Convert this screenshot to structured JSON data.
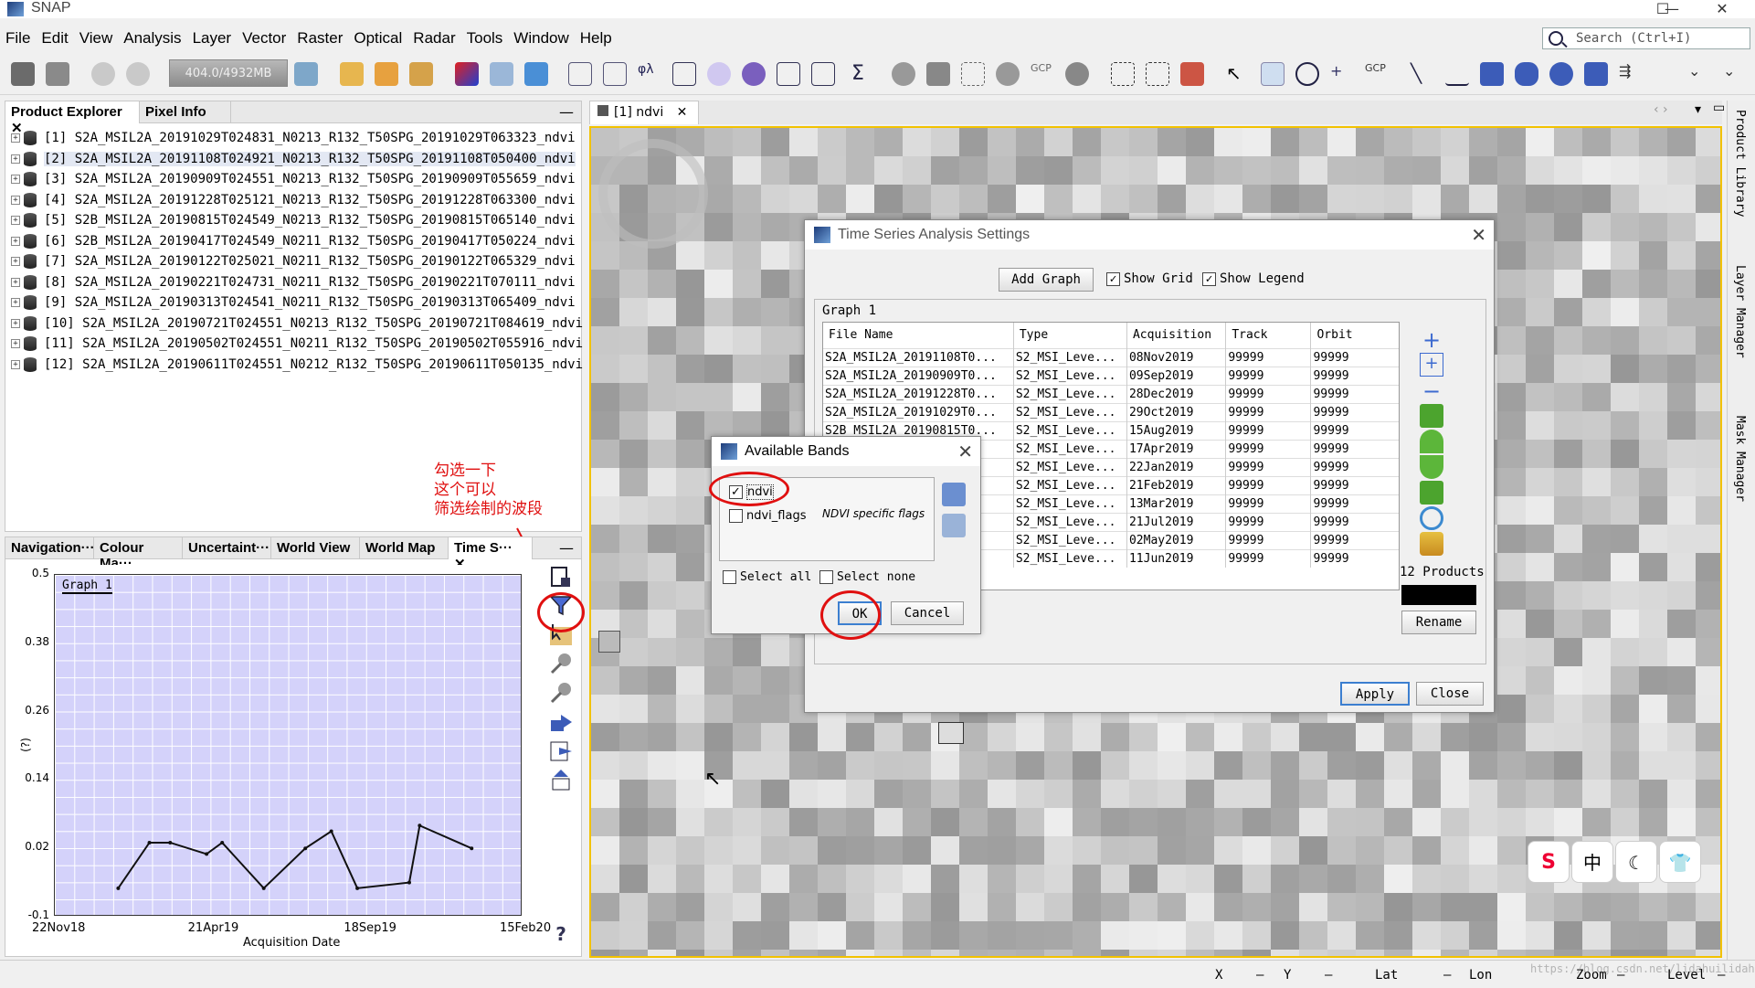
{
  "window": {
    "title": "SNAP",
    "controls": [
      "—",
      "☐",
      "✕"
    ]
  },
  "menu": [
    "File",
    "Edit",
    "View",
    "Analysis",
    "Layer",
    "Vector",
    "Raster",
    "Optical",
    "Radar",
    "Tools",
    "Window",
    "Help"
  ],
  "search": {
    "placeholder": "Search (Ctrl+I)"
  },
  "toolbar": {
    "memory": "404.0/4932MB",
    "gcp_label": "GCP"
  },
  "product_explorer": {
    "tabs": [
      "Product Explorer",
      "Pixel Info"
    ],
    "items": [
      "[1]  S2A_MSIL2A_20191029T024831_N0213_R132_T50SPG_20191029T063323_ndvi",
      "[2]  S2A_MSIL2A_20191108T024921_N0213_R132_T50SPG_20191108T050400_ndvi",
      "[3]  S2A_MSIL2A_20190909T024551_N0213_R132_T50SPG_20190909T055659_ndvi",
      "[4]  S2A_MSIL2A_20191228T025121_N0213_R132_T50SPG_20191228T063300_ndvi",
      "[5]  S2B_MSIL2A_20190815T024549_N0213_R132_T50SPG_20190815T065140_ndvi",
      "[6]  S2B_MSIL2A_20190417T024549_N0211_R132_T50SPG_20190417T050224_ndvi",
      "[7]  S2A_MSIL2A_20190122T025021_N0211_R132_T50SPG_20190122T065329_ndvi",
      "[8]  S2A_MSIL2A_20190221T024731_N0211_R132_T50SPG_20190221T070111_ndvi",
      "[9]  S2A_MSIL2A_20190313T024541_N0211_R132_T50SPG_20190313T065409_ndvi",
      "[10]  S2A_MSIL2A_20190721T024551_N0213_R132_T50SPG_20190721T084619_ndvi",
      "[11]  S2A_MSIL2A_20190502T024551_N0211_R132_T50SPG_20190502T055916_ndvi",
      "[12]  S2A_MSIL2A_20190611T024551_N0212_R132_T50SPG_20190611T050135_ndvi"
    ],
    "selected_index": 1
  },
  "annotation": {
    "line1": "勾选一下",
    "line2": "这个可以",
    "line3": "筛选绘制的波段"
  },
  "bottom_tabs": [
    "Navigation···",
    "Colour Ma···",
    "Uncertaint···",
    "World View",
    "World Map",
    "Time S···"
  ],
  "image_view": {
    "tab": "[1] ndvi"
  },
  "right_strip": [
    "Product Library",
    "Layer Manager",
    "Mask Manager"
  ],
  "status": {
    "x": "X",
    "y": "Y",
    "lat": "Lat",
    "lon": "Lon",
    "zoom": "Zoom",
    "level": "Level",
    "watermark": "https://blog.csdn.net/lidahuilidahui"
  },
  "ts_settings": {
    "title": "Time Series Analysis Settings",
    "add_graph": "Add Graph",
    "show_grid": "Show Grid",
    "show_legend": "Show Legend",
    "graph_label": "Graph 1",
    "columns": [
      "File Name",
      "Type",
      "Acquisition",
      "Track",
      "Orbit"
    ],
    "rows": [
      [
        "S2A_MSIL2A_20191108T0...",
        "S2_MSI_Leve...",
        "08Nov2019",
        "99999",
        "99999"
      ],
      [
        "S2A_MSIL2A_20190909T0...",
        "S2_MSI_Leve...",
        "09Sep2019",
        "99999",
        "99999"
      ],
      [
        "S2A_MSIL2A_20191228T0...",
        "S2_MSI_Leve...",
        "28Dec2019",
        "99999",
        "99999"
      ],
      [
        "S2A_MSIL2A_20191029T0...",
        "S2_MSI_Leve...",
        "29Oct2019",
        "99999",
        "99999"
      ],
      [
        "S2B_MSIL2A_20190815T0...",
        "S2_MSI_Leve...",
        "15Aug2019",
        "99999",
        "99999"
      ],
      [
        "",
        "S2_MSI_Leve...",
        "17Apr2019",
        "99999",
        "99999"
      ],
      [
        "",
        "S2_MSI_Leve...",
        "22Jan2019",
        "99999",
        "99999"
      ],
      [
        "",
        "S2_MSI_Leve...",
        "21Feb2019",
        "99999",
        "99999"
      ],
      [
        "",
        "S2_MSI_Leve...",
        "13Mar2019",
        "99999",
        "99999"
      ],
      [
        "",
        "S2_MSI_Leve...",
        "21Jul2019",
        "99999",
        "99999"
      ],
      [
        "",
        "S2_MSI_Leve...",
        "02May2019",
        "99999",
        "99999"
      ],
      [
        "",
        "S2_MSI_Leve...",
        "11Jun2019",
        "99999",
        "99999"
      ]
    ],
    "products_count": "12 Products",
    "rename": "Rename",
    "apply": "Apply",
    "close": "Close"
  },
  "available_bands": {
    "title": "Available Bands",
    "bands": [
      {
        "name": "ndvi",
        "checked": true,
        "desc": ""
      },
      {
        "name": "ndvi_flags",
        "checked": false,
        "desc": "NDVI specific flags"
      }
    ],
    "select_all": "Select all",
    "select_none": "Select none",
    "ok": "OK",
    "cancel": "Cancel"
  },
  "chart_data": {
    "type": "line",
    "title": "Graph 1",
    "xlabel": "Acquisition Date",
    "ylabel": "(?)",
    "x_ticks": [
      "22Nov18",
      "21Apr19",
      "18Sep19",
      "15Feb20"
    ],
    "y_ticks": [
      "0.5",
      "0.38",
      "0.26",
      "0.14",
      "0.02",
      "-0.1"
    ],
    "ylim": [
      -0.1,
      0.5
    ],
    "xlim": [
      "2018-11-22",
      "2020-02-15"
    ],
    "x": [
      "2019-01-22",
      "2019-02-21",
      "2019-03-13",
      "2019-04-17",
      "2019-05-02",
      "2019-06-11",
      "2019-07-21",
      "2019-08-15",
      "2019-09-09",
      "2019-10-29",
      "2019-11-08",
      "2019-12-28"
    ],
    "values": [
      -0.05,
      0.03,
      0.03,
      0.01,
      0.03,
      -0.05,
      0.02,
      0.05,
      -0.05,
      -0.04,
      0.06,
      0.02
    ]
  }
}
